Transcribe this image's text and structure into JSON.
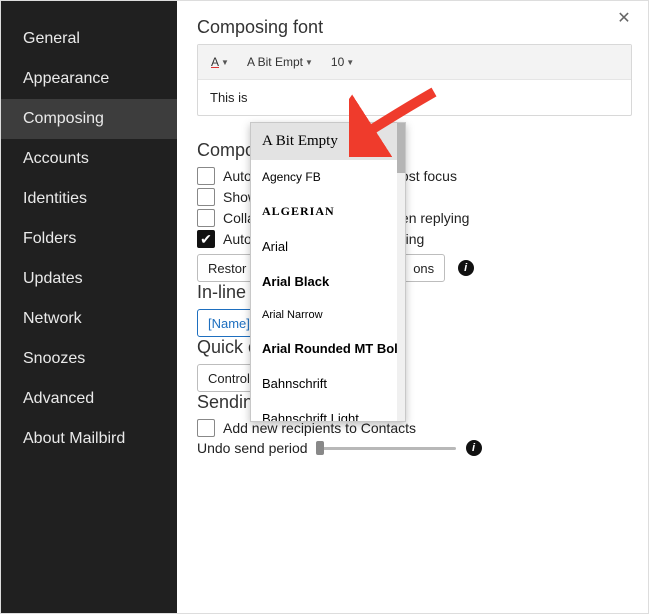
{
  "sidebar": {
    "items": [
      {
        "label": "General"
      },
      {
        "label": "Appearance"
      },
      {
        "label": "Composing",
        "selected": true
      },
      {
        "label": "Accounts"
      },
      {
        "label": "Identities"
      },
      {
        "label": "Folders"
      },
      {
        "label": "Updates"
      },
      {
        "label": "Network"
      },
      {
        "label": "Snoozes"
      },
      {
        "label": "Advanced"
      },
      {
        "label": "About Mailbird"
      }
    ]
  },
  "sections": {
    "composing_font": "Composing font",
    "compo": "Compo",
    "inline": "In-line",
    "quick_compose": "Quick compose shortcut",
    "sending": "Sending"
  },
  "font_toolbar": {
    "color_glyph": "A",
    "font_selected": "A Bit Empt",
    "size_selected": "10"
  },
  "font_preview": "This is",
  "font_dropdown": {
    "items": [
      {
        "label": "A Bit Empty",
        "hover": true,
        "style": "font-family:'Comic Sans MS',cursive;font-size:15px;"
      },
      {
        "label": "Agency FB",
        "style": "font-family:'Agency FB',Arial Narrow,sans-serif;font-size:12px;"
      },
      {
        "label": "ALGERIAN",
        "style": "font-family:Algerian, fantasy;font-weight:bold;letter-spacing:1px;font-size:12px;"
      },
      {
        "label": "Arial",
        "style": "font-family:Arial;font-size:13px;"
      },
      {
        "label": "Arial Black",
        "style": "font-family:'Arial Black',Arial;font-weight:900;font-size:13px;"
      },
      {
        "label": "Arial Narrow",
        "style": "font-family:'Arial Narrow',Arial;font-size:11px;"
      },
      {
        "label": "Arial Rounded MT Bold",
        "style": "font-family:'Arial Rounded MT Bold',Arial;font-weight:bold;font-size:13px;"
      },
      {
        "label": "Bahnschrift",
        "style": "font-family:Bahnschrift,Arial;font-size:13px;"
      },
      {
        "label": "Bahnschrift Light",
        "style": "font-family:Bahnschrift,Arial;font-weight:300;font-size:13px;"
      }
    ]
  },
  "compose_opts": [
    {
      "label_pre": "Auto",
      "label_post": " lost focus",
      "checked": false
    },
    {
      "label_pre": "Show",
      "label_post": "",
      "checked": false
    },
    {
      "label_pre": "Colla",
      "label_post": "en replying",
      "checked": false
    },
    {
      "label_pre": "Auto",
      "label_post": "ging",
      "checked": true
    }
  ],
  "compose_buttons": {
    "restore": "Restor",
    "options": "ons"
  },
  "inline_reply": {
    "name_prefix": "[Name]"
  },
  "quick_compose_shortcut": "Control + Alt + Space",
  "sending": {
    "add_contacts": "Add new recipients to Contacts",
    "undo_label": "Undo send period"
  }
}
